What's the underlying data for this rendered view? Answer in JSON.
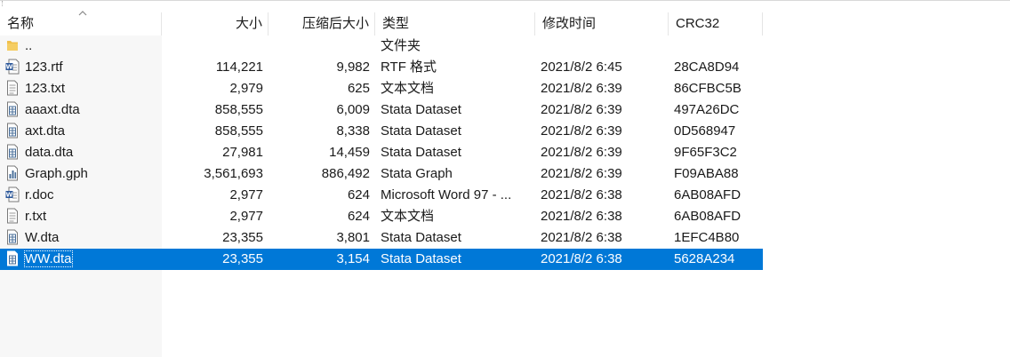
{
  "columns": {
    "name": "名称",
    "size": "大小",
    "compressed": "压缩后大小",
    "type": "类型",
    "modified": "修改时间",
    "crc": "CRC32"
  },
  "sort": {
    "column": "name",
    "direction": "ascending"
  },
  "selected_index": 11,
  "files": [
    {
      "name": "..",
      "size": "",
      "compressed": "",
      "type": "文件夹",
      "modified": "",
      "crc": "",
      "icon": "folder-icon"
    },
    {
      "name": "123.rtf",
      "size": "114,221",
      "compressed": "9,982",
      "type": "RTF 格式",
      "modified": "2021/8/2 6:45",
      "crc": "28CA8D94",
      "icon": "word-document-icon"
    },
    {
      "name": "123.txt",
      "size": "2,979",
      "compressed": "625",
      "type": "文本文档",
      "modified": "2021/8/2 6:39",
      "crc": "86CFBC5B",
      "icon": "text-file-icon"
    },
    {
      "name": "aaaxt.dta",
      "size": "858,555",
      "compressed": "6,009",
      "type": "Stata Dataset",
      "modified": "2021/8/2 6:39",
      "crc": "497A26DC",
      "icon": "dataset-file-icon"
    },
    {
      "name": "axt.dta",
      "size": "858,555",
      "compressed": "8,338",
      "type": "Stata Dataset",
      "modified": "2021/8/2 6:39",
      "crc": "0D568947",
      "icon": "dataset-file-icon"
    },
    {
      "name": "data.dta",
      "size": "27,981",
      "compressed": "14,459",
      "type": "Stata Dataset",
      "modified": "2021/8/2 6:39",
      "crc": "9F65F3C2",
      "icon": "dataset-file-icon"
    },
    {
      "name": "Graph.gph",
      "size": "3,561,693",
      "compressed": "886,492",
      "type": "Stata Graph",
      "modified": "2021/8/2 6:39",
      "crc": "F09ABA88",
      "icon": "graph-file-icon"
    },
    {
      "name": "r.doc",
      "size": "2,977",
      "compressed": "624",
      "type": "Microsoft Word 97 - ...",
      "modified": "2021/8/2 6:38",
      "crc": "6AB08AFD",
      "icon": "word-document-icon"
    },
    {
      "name": "r.txt",
      "size": "2,977",
      "compressed": "624",
      "type": "文本文档",
      "modified": "2021/8/2 6:38",
      "crc": "6AB08AFD",
      "icon": "text-file-icon"
    },
    {
      "name": "W.dta",
      "size": "23,355",
      "compressed": "3,801",
      "type": "Stata Dataset",
      "modified": "2021/8/2 6:38",
      "crc": "1EFC4B80",
      "icon": "dataset-file-icon"
    },
    {
      "name": "WW.dta",
      "size": "23,355",
      "compressed": "3,154",
      "type": "Stata Dataset",
      "modified": "2021/8/2 6:38",
      "crc": "5628A234",
      "icon": "dataset-file-icon"
    }
  ],
  "colors": {
    "selection": "#0078d7",
    "folder": "#f0c04c",
    "word": "#2b579a",
    "stata": "#4a6f9a"
  }
}
